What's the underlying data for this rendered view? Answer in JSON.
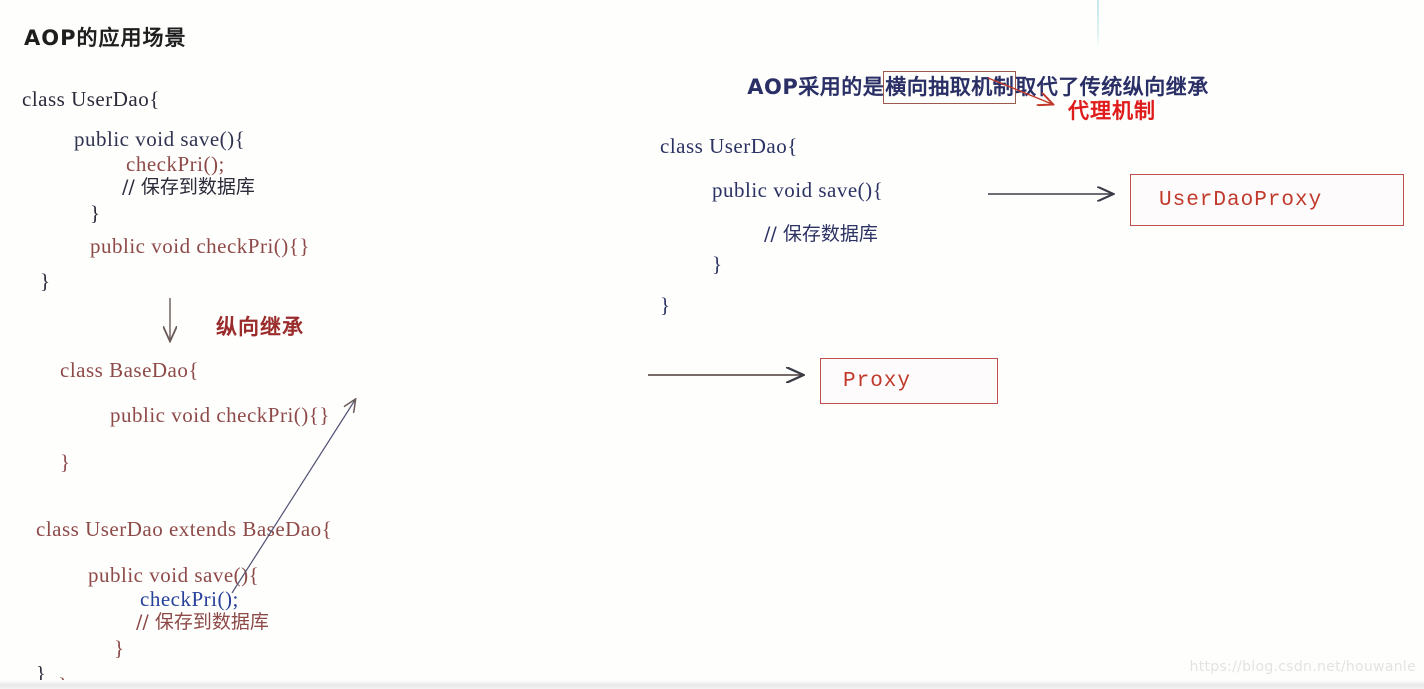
{
  "page": {
    "heading": "AOP的应用场景",
    "watermark": "https://blog.csdn.net/houwanle",
    "background": "#fefefd"
  },
  "colors": {
    "dark_ink": "#2b2b3a",
    "navy_ink": "#2f3350",
    "maroon_ink": "#8d4a48",
    "red_accent": "#e01b1b",
    "dark_red": "#9b2c2c",
    "blue_ink": "#27409a",
    "box_border": "#c0504d",
    "box_text": "#c0392b",
    "title_ink": "#2a2f66",
    "highlight_box_border": "#9a5b4e"
  },
  "left_panel": {
    "block1": {
      "name": "UserDao with inline checkPri",
      "lines": [
        {
          "text": "class UserDao{",
          "color": "dark",
          "indent": 0
        },
        {
          "text": "public void save(){",
          "color": "navy",
          "indent": 1
        },
        {
          "text": "checkPri();",
          "color": "maroon",
          "indent": 2
        },
        {
          "text": "// 保存到数据库",
          "color": "dark",
          "indent": 2
        },
        {
          "text": "}",
          "color": "dark",
          "indent": 1
        },
        {
          "text": "public void checkPri(){}",
          "color": "maroon",
          "indent": 1
        },
        {
          "text": "}",
          "color": "dark",
          "indent": 0
        }
      ]
    },
    "arrow_label": "纵向继承",
    "block2": {
      "name": "BaseDao",
      "lines": [
        {
          "text": "class BaseDao{",
          "color": "maroon",
          "indent": 0
        },
        {
          "text": "public void checkPri(){}",
          "color": "maroon",
          "indent": 1
        },
        {
          "text": "}",
          "color": "maroon",
          "indent": 0
        }
      ]
    },
    "block3": {
      "name": "UserDao extends BaseDao",
      "lines": [
        {
          "text": "class UserDao extends BaseDao{",
          "color": "maroon",
          "indent": 0
        },
        {
          "text": "public void save(){",
          "color": "maroon",
          "indent": 1
        },
        {
          "text": "checkPri();",
          "color": "blue",
          "indent": 2
        },
        {
          "text": "// 保存到数据库",
          "color": "maroon",
          "indent": 2
        },
        {
          "text": "}",
          "color": "maroon",
          "indent": 1
        },
        {
          "text": "}",
          "color": "maroon",
          "indent": 0
        }
      ]
    }
  },
  "right_panel": {
    "title": {
      "prefix": "AOP采用的是",
      "highlight": "横向抽取机制",
      "suffix": "取代了传统纵向继承"
    },
    "proxy_label": "代理机制",
    "block": {
      "name": "UserDao clean",
      "lines": [
        {
          "text": "class UserDao{",
          "color": "navy",
          "indent": 0
        },
        {
          "text": "public void save(){",
          "color": "navy",
          "indent": 1
        },
        {
          "text": "// 保存数据库",
          "color": "navy",
          "indent": 2
        },
        {
          "text": "}",
          "color": "navy",
          "indent": 1
        },
        {
          "text": "}",
          "color": "navy",
          "indent": 0
        }
      ]
    },
    "boxes": [
      {
        "label": "UserDaoProxy"
      },
      {
        "label": "Proxy"
      }
    ]
  }
}
